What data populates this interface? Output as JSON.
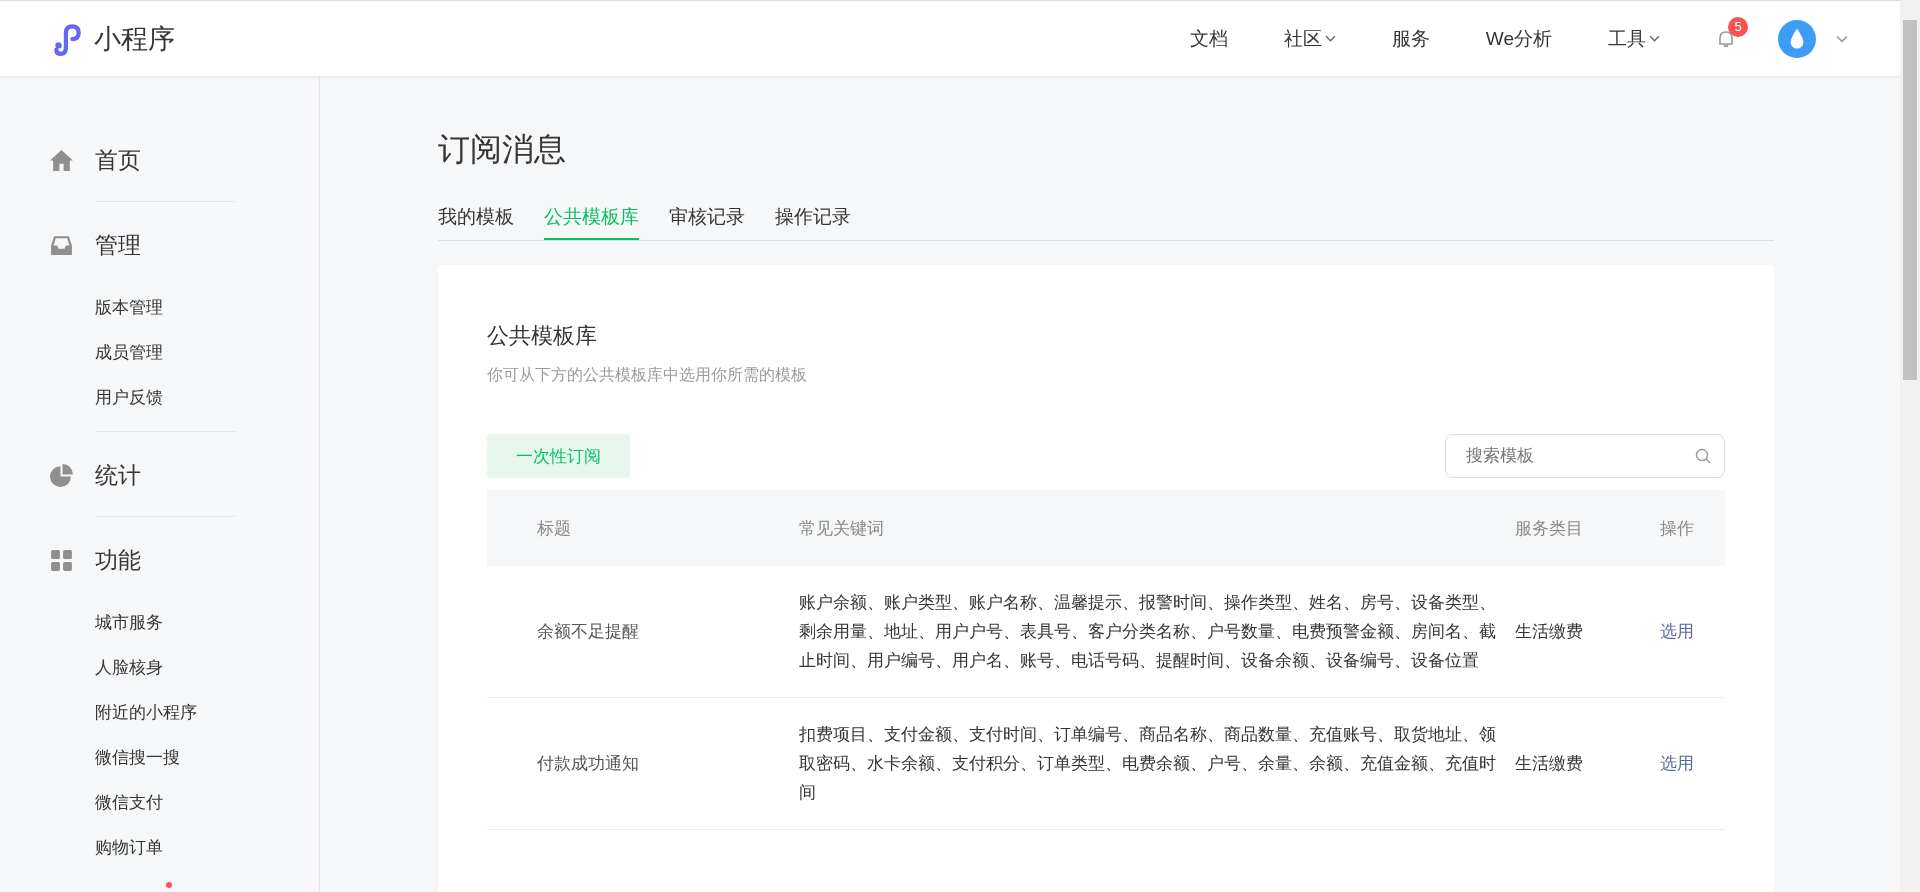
{
  "header": {
    "logo_text": "小程序",
    "nav": [
      {
        "label": "文档",
        "dropdown": false
      },
      {
        "label": "社区",
        "dropdown": true
      },
      {
        "label": "服务",
        "dropdown": false
      },
      {
        "label": "We分析",
        "dropdown": false
      },
      {
        "label": "工具",
        "dropdown": true
      }
    ],
    "notification_count": "5"
  },
  "sidebar": {
    "sections": [
      {
        "label": "首页"
      },
      {
        "label": "管理",
        "items": [
          {
            "label": "版本管理",
            "dot": false
          },
          {
            "label": "成员管理",
            "dot": false
          },
          {
            "label": "用户反馈",
            "dot": false
          }
        ]
      },
      {
        "label": "统计"
      },
      {
        "label": "功能",
        "items": [
          {
            "label": "城市服务",
            "dot": false
          },
          {
            "label": "人脸核身",
            "dot": false
          },
          {
            "label": "附近的小程序",
            "dot": false
          },
          {
            "label": "微信搜一搜",
            "dot": false
          },
          {
            "label": "微信支付",
            "dot": false
          },
          {
            "label": "购物订单",
            "dot": false
          },
          {
            "dot": true
          }
        ]
      }
    ]
  },
  "page_title": "订阅消息",
  "tabs": [
    {
      "label": "我的模板",
      "selected": false
    },
    {
      "label": "公共模板库",
      "selected": true
    },
    {
      "label": "审核记录",
      "selected": false
    },
    {
      "label": "操作记录",
      "selected": false
    }
  ],
  "card": {
    "title": "公共模板库",
    "subtitle": "你可从下方的公共模板库中选用你所需的模板",
    "filter_button": "一次性订阅",
    "search": {
      "placeholder": "搜索模板"
    },
    "table": {
      "columns": [
        "标题",
        "常见关键词",
        "服务类目",
        "操作"
      ],
      "rows": [
        {
          "title": "余额不足提醒",
          "keywords": "账户余额、账户类型、账户名称、温馨提示、报警时间、操作类型、姓名、房号、设备类型、剩余用量、地址、用户户号、表具号、客户分类名称、户号数量、电费预警金额、房间名、截止时间、用户编号、用户名、账号、电话号码、提醒时间、设备余额、设备编号、设备位置",
          "category": "生活缴费",
          "action": "选用"
        },
        {
          "title": "付款成功通知",
          "keywords": "扣费项目、支付金额、支付时间、订单编号、商品名称、商品数量、充值账号、取货地址、领取密码、水卡余额、支付积分、订单类型、电费余额、户号、余量、余额、充值金额、充值时间",
          "category": "生活缴费",
          "action": "选用"
        }
      ]
    }
  }
}
